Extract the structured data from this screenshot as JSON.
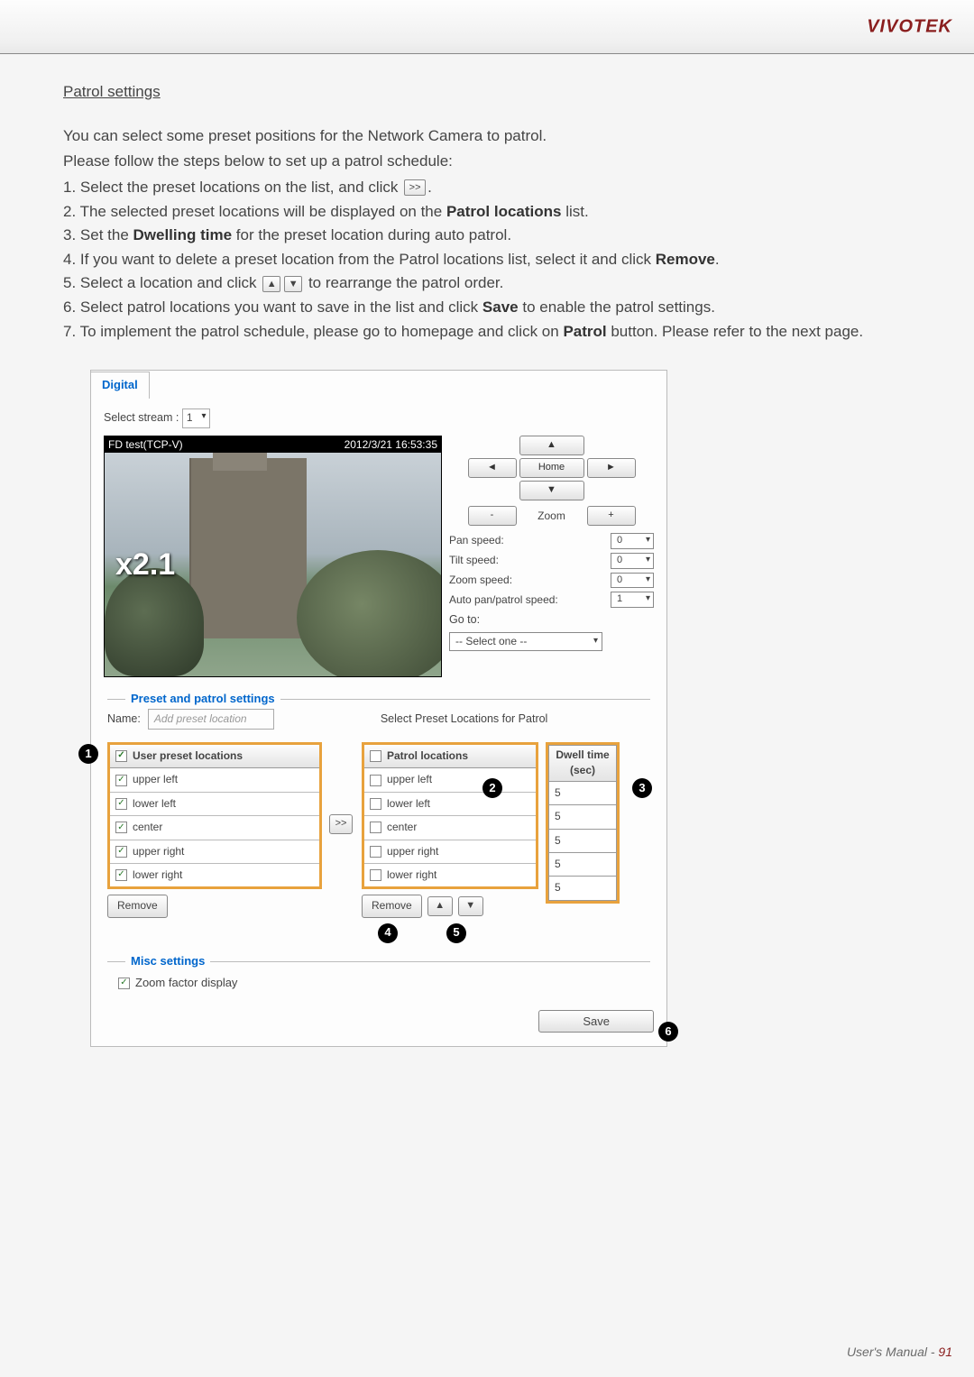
{
  "brand": "VIVOTEK",
  "section_title": "Patrol settings",
  "intro_line1": "You can select some preset positions for the Network Camera to patrol.",
  "intro_line2": "Please follow the steps below to set up a patrol schedule:",
  "steps": {
    "s1a": "1. Select the preset locations on the list, and click ",
    "s1b": ".",
    "s2a": "2. The selected preset locations will be displayed on the ",
    "s2b": "Patrol locations",
    "s2c": " list.",
    "s3a": "3. Set the ",
    "s3b": "Dwelling time",
    "s3c": " for the preset location during auto patrol.",
    "s4a": "4. If you want to delete a preset location from the Patrol locations list, select it and click ",
    "s4b": "Remove",
    "s4c": ".",
    "s5a": "5. Select a location and click ",
    "s5b": " to rearrange the patrol order.",
    "s6a": "6. Select patrol locations you want to save in the list and click ",
    "s6b": "Save",
    "s6c": " to enable the patrol settings.",
    "s7a": "7. To implement the patrol schedule, please go to homepage and click on ",
    "s7b": "Patrol",
    "s7c": " button. Please refer to the next page."
  },
  "icons": {
    "add": ">>",
    "up": "▲",
    "down": "▼",
    "left": "◄",
    "right": "►",
    "minus": "-",
    "plus": "+"
  },
  "app": {
    "tab": "Digital",
    "stream_label": "Select stream :",
    "stream_value": "1",
    "video_label": "FD test(TCP-V)",
    "video_time": "2012/3/21 16:53:35",
    "zoom_overlay": "x2.1",
    "ptz": {
      "home": "Home",
      "zoom": "Zoom",
      "pan_speed_label": "Pan speed:",
      "pan_speed": "0",
      "tilt_speed_label": "Tilt speed:",
      "tilt_speed": "0",
      "zoom_speed_label": "Zoom speed:",
      "zoom_speed": "0",
      "auto_speed_label": "Auto pan/patrol speed:",
      "auto_speed": "1",
      "goto_label": "Go to:",
      "goto_value": "-- Select one --"
    },
    "preset_legend": "Preset and patrol settings",
    "name_label": "Name:",
    "name_placeholder": "Add preset location",
    "select_patrol_label": "Select Preset Locations for Patrol",
    "preset_header": "User preset locations",
    "patrol_header": "Patrol locations",
    "dwell_header1": "Dwell time",
    "dwell_header2": "(sec)",
    "preset_items": [
      "upper left",
      "lower left",
      "center",
      "upper right",
      "lower right"
    ],
    "patrol_items": [
      "upper left",
      "lower left",
      "center",
      "upper right",
      "lower right"
    ],
    "dwell_values": [
      "5",
      "5",
      "5",
      "5",
      "5"
    ],
    "remove_btn": "Remove",
    "misc_legend": "Misc settings",
    "misc_zoom": "Zoom factor display",
    "save_btn": "Save"
  },
  "annotations": {
    "a1": "1",
    "a2": "2",
    "a3": "3",
    "a4": "4",
    "a5": "5",
    "a6": "6"
  },
  "footer_text": "User's Manual - ",
  "footer_page": "91"
}
